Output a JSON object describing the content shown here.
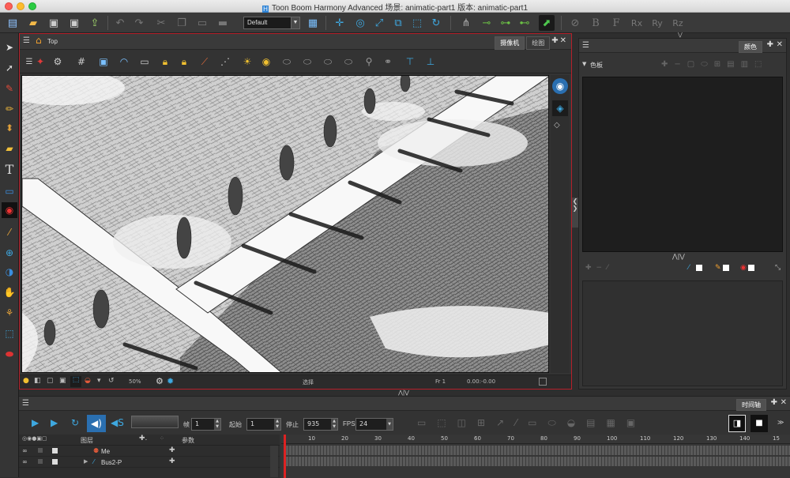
{
  "window": {
    "title": "Toon Boom Harmony Advanced 场景: animatic-part1 版本: animatic-part1",
    "app_icon": "H"
  },
  "toolbar": {
    "workspace_combo": "Default"
  },
  "camera_view": {
    "breadcrumb": "Top",
    "tabs": [
      {
        "label": "摄像机",
        "active": true
      },
      {
        "label": "绘图",
        "active": false
      }
    ],
    "status": {
      "mode": "选择",
      "frame": "Fr 1",
      "coords": "0.00:-0.00",
      "zoom": "50%"
    }
  },
  "color_panel": {
    "tab_label": "颜色",
    "palette_label": "色板"
  },
  "timeline": {
    "tab_label": "时间轴",
    "frame_label": "帧",
    "frame_value": "1",
    "start_label": "起始",
    "start_value": "1",
    "stop_label": "停止",
    "stop_value": "935",
    "fps_label": "FPS",
    "fps_value": "24",
    "layers_header": "图层",
    "params_header": "参数",
    "layers": [
      {
        "name": "Me"
      },
      {
        "name": "Bus2-P"
      }
    ],
    "ruler_ticks": [
      "10",
      "20",
      "30",
      "40",
      "50",
      "60",
      "70",
      "80",
      "90",
      "100",
      "110",
      "120",
      "130",
      "140",
      "15"
    ]
  }
}
